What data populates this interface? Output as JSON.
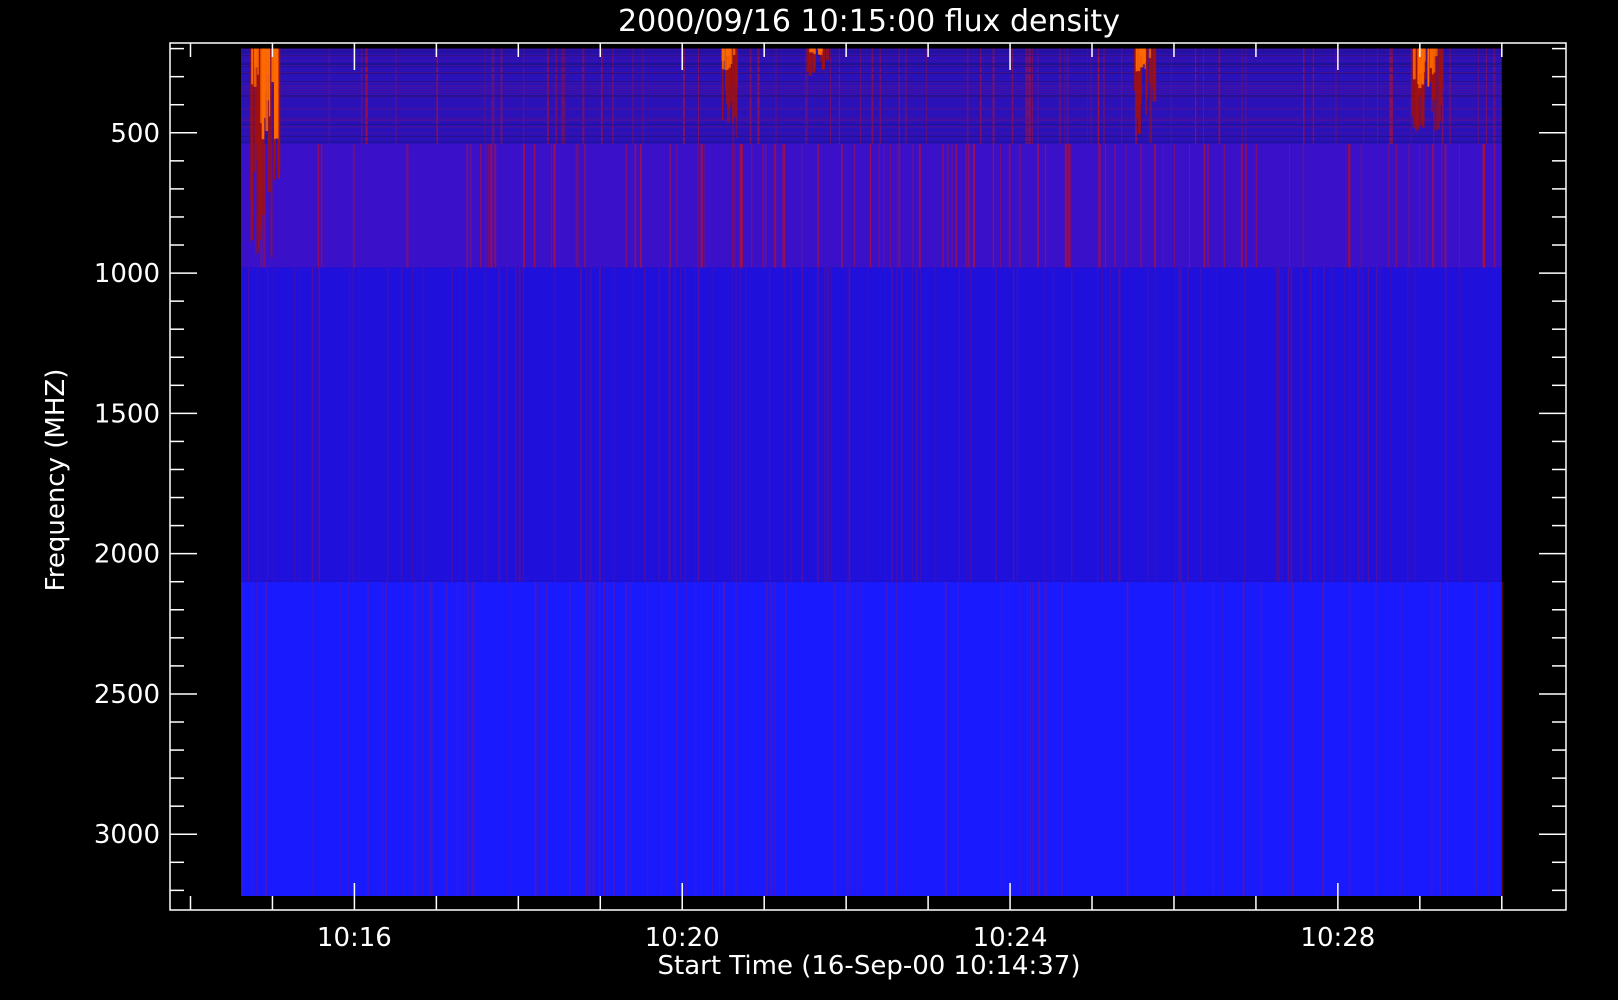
{
  "chart_data": {
    "type": "heatmap",
    "title": "2000/09/16 10:15:00 flux density",
    "xlabel": "Start Time (16-Sep-00 10:14:37)",
    "ylabel": "Frequency (MHZ)",
    "x_start": "10:14:37",
    "x_end": "10:30:00",
    "xlim": [
      "10:13:45",
      "10:30:47"
    ],
    "ylim": [
      3270,
      180
    ],
    "x_major_ticks": [
      "10:16",
      "10:20",
      "10:24",
      "10:28"
    ],
    "x_minor_tick_interval_minutes": 1,
    "y_major_ticks": [
      500,
      1000,
      1500,
      2000,
      2500,
      3000
    ],
    "y_minor_tick_interval": 100,
    "frequency_bands": [
      {
        "from": 200,
        "to": 540,
        "description": "noisy band with bursts"
      },
      {
        "from": 540,
        "to": 980,
        "description": "dark blue with red striations"
      },
      {
        "from": 980,
        "to": 2100,
        "description": "blue"
      },
      {
        "from": 2100,
        "to": 3220,
        "description": "bright blue"
      }
    ],
    "bursts": [
      {
        "time": "10:14:50",
        "freq_from": 200,
        "freq_to": 950,
        "intensity": "strong"
      },
      {
        "time": "10:20:30",
        "freq_from": 200,
        "freq_to": 540,
        "intensity": "moderate"
      },
      {
        "time": "10:21:35",
        "freq_from": 200,
        "freq_to": 300,
        "intensity": "moderate"
      },
      {
        "time": "10:25:35",
        "freq_from": 200,
        "freq_to": 540,
        "intensity": "moderate"
      },
      {
        "time": "10:29:00",
        "freq_from": 200,
        "freq_to": 500,
        "intensity": "strong"
      }
    ],
    "colors": {
      "background": "#000000",
      "axes": "#ffffff",
      "band_low": "#2a12b8",
      "band_mid": "#3a10c8",
      "band_high": "#1f10dc",
      "band_bright": "#1a1aff",
      "burst_core": "#ff6a00",
      "burst_halo": "#a01010"
    },
    "grid": false,
    "legend": "none"
  }
}
